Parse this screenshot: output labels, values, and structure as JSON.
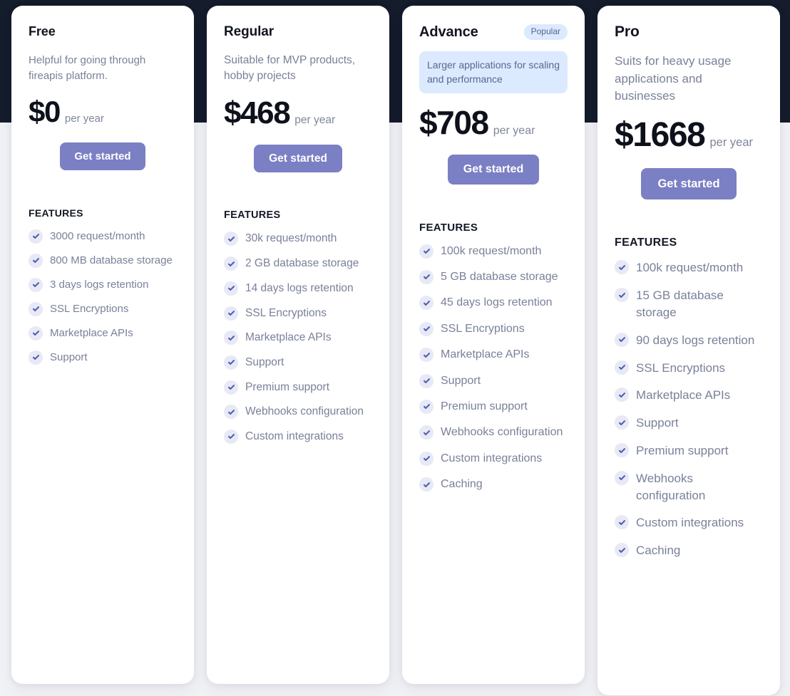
{
  "theme": {
    "page_background": "#f1f2f6",
    "header_band": "#151c2c",
    "card_background": "#ffffff",
    "accent_button": "#7b7fc4",
    "badge_background": "#dbeafe",
    "badge_text": "#55638e",
    "check_circle": "#e7e9f5",
    "check_mark": "#4f5bb5",
    "muted_text": "#7a8199",
    "title_text": "#12151f"
  },
  "features_heading": "FEATURES",
  "cta_label": "Get started",
  "plans": [
    {
      "name": "Free",
      "badge": "",
      "description": "Helpful for going through fireapis platform.",
      "description_highlighted": false,
      "price": "$0",
      "period": "per year",
      "cta": "Get started",
      "features": [
        "3000 request/month",
        "800 MB database storage",
        "3 days logs retention",
        "SSL Encryptions",
        "Marketplace APIs",
        "Support"
      ]
    },
    {
      "name": "Regular",
      "badge": "",
      "description": "Suitable for MVP products, hobby projects",
      "description_highlighted": false,
      "price": "$468",
      "period": "per year",
      "cta": "Get started",
      "features": [
        "30k request/month",
        "2 GB database storage",
        "14 days logs retention",
        "SSL Encryptions",
        "Marketplace APIs",
        "Support",
        "Premium support",
        "Webhooks configuration",
        "Custom integrations"
      ]
    },
    {
      "name": "Advance",
      "badge": "Popular",
      "description": "Larger applications for scaling and performance",
      "description_highlighted": true,
      "price": "$708",
      "period": "per year",
      "cta": "Get started",
      "features": [
        "100k request/month",
        "5 GB database storage",
        "45 days logs retention",
        "SSL Encryptions",
        "Marketplace APIs",
        "Support",
        "Premium support",
        "Webhooks configuration",
        "Custom integrations",
        "Caching"
      ]
    },
    {
      "name": "Pro",
      "badge": "",
      "description": "Suits for heavy usage applications and businesses",
      "description_highlighted": false,
      "price": "$1668",
      "period": "per year",
      "cta": "Get started",
      "features": [
        "100k request/month",
        "15 GB database storage",
        "90 days logs retention",
        "SSL Encryptions",
        "Marketplace APIs",
        "Support",
        "Premium support",
        "Webhooks configuration",
        "Custom integrations",
        "Caching"
      ]
    }
  ]
}
